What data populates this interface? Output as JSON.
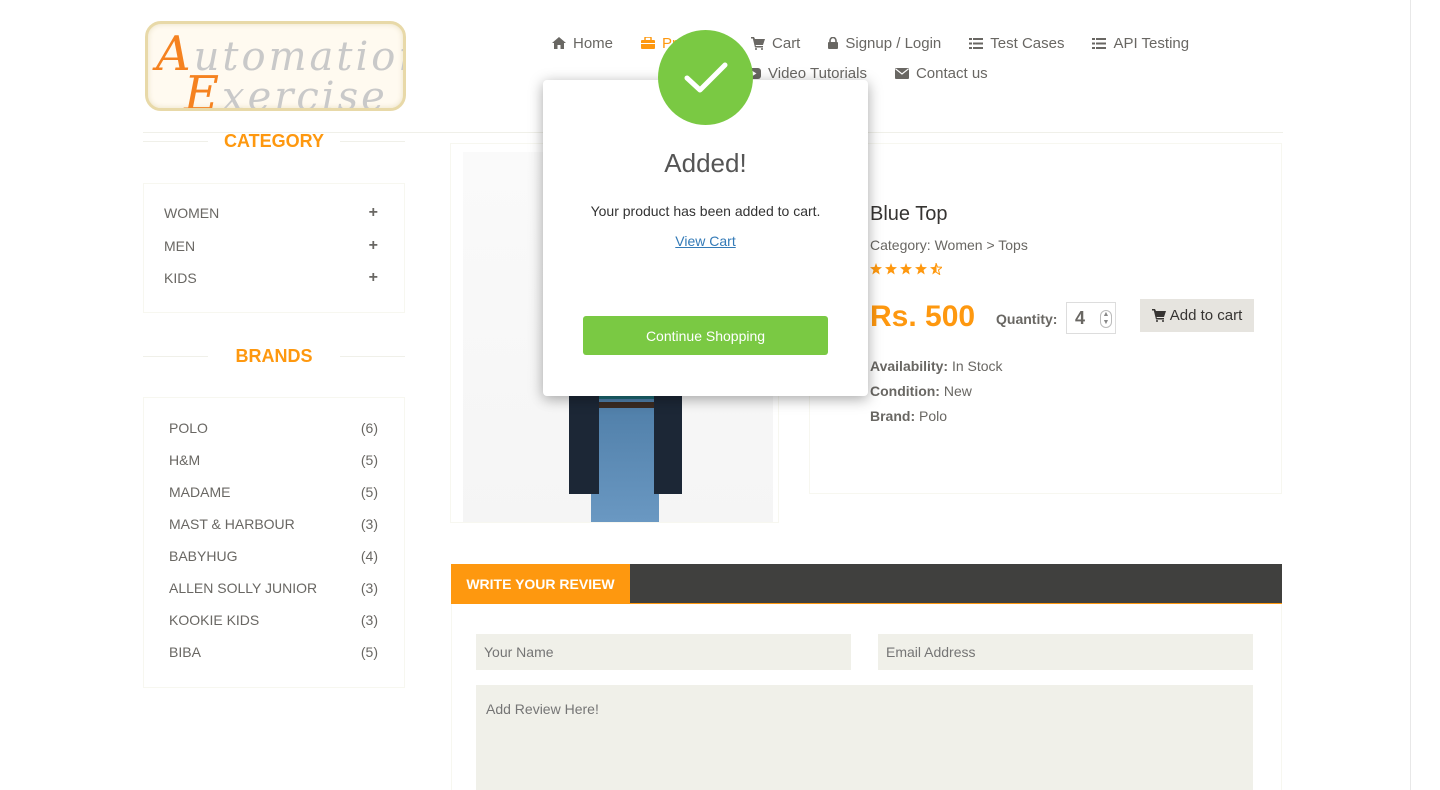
{
  "logo": {
    "line1_big": "A",
    "line1_rest": "utomation",
    "line2_big": "E",
    "line2_rest": "xercise"
  },
  "nav": {
    "items": [
      {
        "label": "Home",
        "icon": "home-icon"
      },
      {
        "label": "Pr",
        "icon": "products-icon"
      },
      {
        "label": "Cart",
        "icon": "cart-icon"
      },
      {
        "label": "Signup / Login",
        "icon": "lock-icon"
      },
      {
        "label": "Test Cases",
        "icon": "list-icon"
      },
      {
        "label": "API Testing",
        "icon": "list-icon"
      },
      {
        "label": "Video Tutorials",
        "icon": "youtube-icon"
      },
      {
        "label": "Contact us",
        "icon": "envelope-icon"
      }
    ]
  },
  "sidebar": {
    "category_title": "CATEGORY",
    "categories": [
      {
        "label": "WOMEN",
        "toggle": "+"
      },
      {
        "label": "MEN",
        "toggle": "+"
      },
      {
        "label": "KIDS",
        "toggle": "+"
      }
    ],
    "brands_title": "BRANDS",
    "brands": [
      {
        "label": "POLO",
        "count": "(6)"
      },
      {
        "label": "H&M",
        "count": "(5)"
      },
      {
        "label": "MADAME",
        "count": "(5)"
      },
      {
        "label": "MAST & HARBOUR",
        "count": "(3)"
      },
      {
        "label": "BABYHUG",
        "count": "(4)"
      },
      {
        "label": "ALLEN SOLLY JUNIOR",
        "count": "(3)"
      },
      {
        "label": "KOOKIE KIDS",
        "count": "(3)"
      },
      {
        "label": "BIBA",
        "count": "(5)"
      }
    ]
  },
  "product": {
    "name": "Blue Top",
    "category": "Category: Women > Tops",
    "rating": 4.5,
    "price": "Rs. 500",
    "quantity_label": "Quantity:",
    "quantity_value": "4",
    "add_to_cart": "Add to cart",
    "availability_label": "Availability:",
    "availability_value": "In Stock",
    "condition_label": "Condition:",
    "condition_value": "New",
    "brand_label": "Brand:",
    "brand_value": "Polo"
  },
  "review": {
    "tab_label": "WRITE YOUR REVIEW",
    "name_placeholder": "Your Name",
    "email_placeholder": "Email Address",
    "review_placeholder": "Add Review Here!"
  },
  "modal": {
    "title": "Added!",
    "message": "Your product has been added to cart.",
    "link_label": "View Cart",
    "button_label": "Continue Shopping",
    "icon": "checkmark-icon"
  },
  "colors": {
    "accent": "#fe980f",
    "success": "#7ac943",
    "text": "#696763",
    "dark_bar": "#40403e",
    "field_bg": "#f0f0e9"
  }
}
